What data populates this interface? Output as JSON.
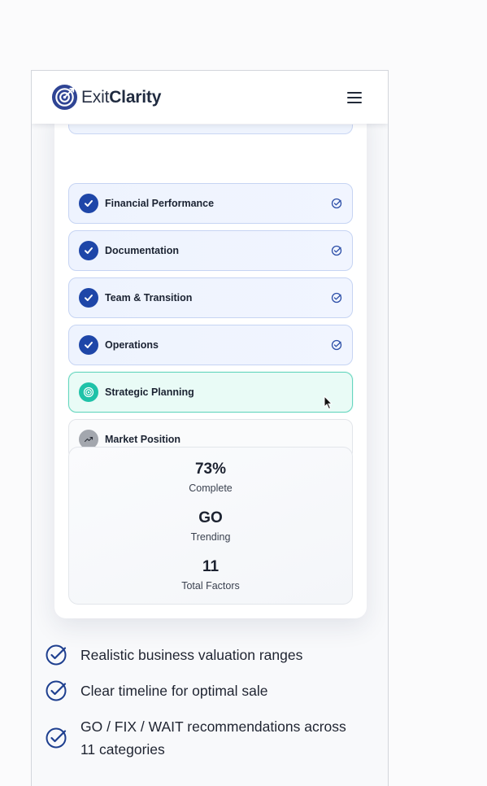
{
  "brand": {
    "name_light": "Exit",
    "name_bold": "Clarity",
    "logo_icon": "target-arrow-logo"
  },
  "header": {
    "menu_icon": "hamburger-menu-icon"
  },
  "factors": [
    {
      "label": "Financial Performance",
      "status": "done"
    },
    {
      "label": "Documentation",
      "status": "done"
    },
    {
      "label": "Team & Transition",
      "status": "done"
    },
    {
      "label": "Operations",
      "status": "done"
    },
    {
      "label": "Strategic Planning",
      "status": "active"
    },
    {
      "label": "Market Position",
      "status": "pending"
    }
  ],
  "stats": {
    "complete": {
      "value": "73%",
      "label": "Complete"
    },
    "trending": {
      "value": "GO",
      "label": "Trending"
    },
    "factors": {
      "value": "11",
      "label": "Total Factors"
    }
  },
  "benefits": [
    "Realistic business valuation ranges",
    "Clear timeline for optimal sale",
    "GO / FIX / WAIT recommendations across 11 categories"
  ],
  "colors": {
    "primary": "#1e46a8",
    "accent_teal": "#1fc2a8",
    "pending_grey": "#a3a7ae"
  }
}
